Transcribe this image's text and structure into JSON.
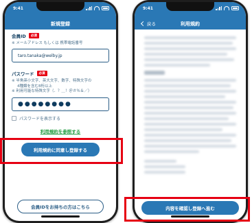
{
  "left_screen": {
    "time": "9:41",
    "title": "新規登録",
    "member_id": {
      "label": "会員ID",
      "required_badge": "必須",
      "hint": "※ メールアドレス もしくは 携帯電話番号",
      "value": "taro.tanaka@welby.jp"
    },
    "password": {
      "label": "パスワード",
      "required_badge": "必須",
      "hint1": "※ 半角英小文字、英大文字、数字、特殊文字の",
      "hint2": "4種類を含む8桁以上",
      "hint3": "※ 利用可能な特殊文字（．？＿！＠＃％＆／）",
      "value": "●●●●●●●●"
    },
    "show_password_label": "パスワードを表示する",
    "terms_link": "利用規約を参照する",
    "register_button": "利用規約に同意し登録する",
    "existing_member_button": "会員IDをお持ちの方はこちら"
  },
  "right_screen": {
    "time": "9:41",
    "back_label": "戻る",
    "title": "利用規約",
    "confirm_button": "内容を確認し登録へ進む"
  },
  "colors": {
    "brand": "#2a78b5",
    "required_badge": "#e60012",
    "link": "#1f9c3f",
    "highlight": "#e60012"
  }
}
